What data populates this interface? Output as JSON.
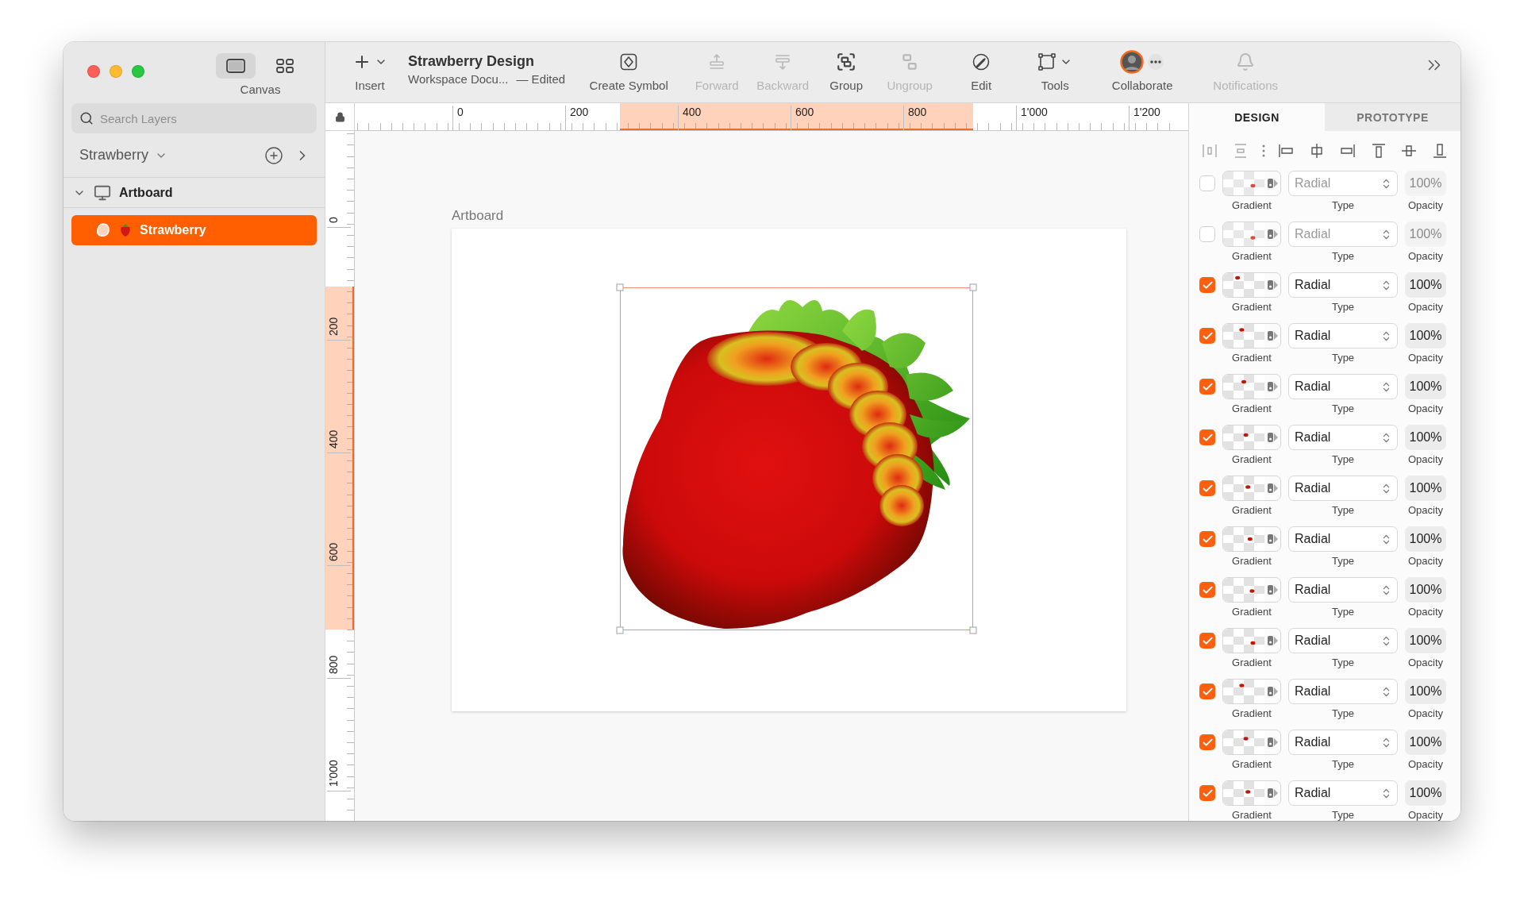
{
  "sidebar": {
    "view_switch": {
      "label": "Canvas",
      "options": [
        {
          "kind": "canvas",
          "selected": true
        },
        {
          "kind": "components",
          "selected": false
        }
      ]
    },
    "search": {
      "placeholder": "Search Layers"
    },
    "page": "Strawberry",
    "layers": [
      {
        "name": "Artboard",
        "expanded": true,
        "selected": false,
        "children": [
          {
            "name": "Strawberry",
            "selected": true
          }
        ]
      }
    ]
  },
  "toolbar": {
    "document": {
      "title": "Strawberry Design",
      "subtitle": "Workspace Docu...",
      "status": "— Edited"
    },
    "items": [
      {
        "kind": "insert",
        "label": "Insert",
        "disabled": false
      },
      {
        "kind": "create_symbol",
        "label": "Create Symbol",
        "disabled": false
      },
      {
        "kind": "forward",
        "label": "Forward",
        "disabled": true
      },
      {
        "kind": "backward",
        "label": "Backward",
        "disabled": true
      },
      {
        "kind": "group",
        "label": "Group",
        "disabled": false
      },
      {
        "kind": "ungroup",
        "label": "Ungroup",
        "disabled": true
      },
      {
        "kind": "edit",
        "label": "Edit",
        "disabled": false
      },
      {
        "kind": "tools",
        "label": "Tools",
        "disabled": false
      },
      {
        "kind": "collaborate",
        "label": "Collaborate",
        "disabled": false
      },
      {
        "kind": "notifications",
        "label": "Notifications",
        "disabled": true
      }
    ]
  },
  "rulers": {
    "horizontal": [
      "0",
      "200",
      "400",
      "600",
      "800",
      "1'000",
      "1'200"
    ],
    "vertical": [
      "0",
      "200",
      "400",
      "600",
      "800",
      "1'000"
    ]
  },
  "canvas": {
    "artboard_label": "Artboard"
  },
  "inspector": {
    "tabs": [
      {
        "label": "DESIGN",
        "selected": true
      },
      {
        "label": "PROTOTYPE",
        "selected": false
      }
    ],
    "fills": [
      {
        "enabled": false,
        "gradient_label": "Gradient",
        "type": "Radial",
        "type_label": "Type",
        "opacity": "100%",
        "opacity_label": "Opacity"
      },
      {
        "enabled": false,
        "gradient_label": "Gradient",
        "type": "Radial",
        "type_label": "Type",
        "opacity": "100%",
        "opacity_label": "Opacity"
      },
      {
        "enabled": true,
        "gradient_label": "Gradient",
        "type": "Radial",
        "type_label": "Type",
        "opacity": "100%",
        "opacity_label": "Opacity"
      },
      {
        "enabled": true,
        "gradient_label": "Gradient",
        "type": "Radial",
        "type_label": "Type",
        "opacity": "100%",
        "opacity_label": "Opacity"
      },
      {
        "enabled": true,
        "gradient_label": "Gradient",
        "type": "Radial",
        "type_label": "Type",
        "opacity": "100%",
        "opacity_label": "Opacity"
      },
      {
        "enabled": true,
        "gradient_label": "Gradient",
        "type": "Radial",
        "type_label": "Type",
        "opacity": "100%",
        "opacity_label": "Opacity"
      },
      {
        "enabled": true,
        "gradient_label": "Gradient",
        "type": "Radial",
        "type_label": "Type",
        "opacity": "100%",
        "opacity_label": "Opacity"
      },
      {
        "enabled": true,
        "gradient_label": "Gradient",
        "type": "Radial",
        "type_label": "Type",
        "opacity": "100%",
        "opacity_label": "Opacity"
      },
      {
        "enabled": true,
        "gradient_label": "Gradient",
        "type": "Radial",
        "type_label": "Type",
        "opacity": "100%",
        "opacity_label": "Opacity"
      },
      {
        "enabled": true,
        "gradient_label": "Gradient",
        "type": "Radial",
        "type_label": "Type",
        "opacity": "100%",
        "opacity_label": "Opacity"
      },
      {
        "enabled": true,
        "gradient_label": "Gradient",
        "type": "Radial",
        "type_label": "Type",
        "opacity": "100%",
        "opacity_label": "Opacity"
      },
      {
        "enabled": true,
        "gradient_label": "Gradient",
        "type": "Radial",
        "type_label": "Type",
        "opacity": "100%",
        "opacity_label": "Opacity"
      },
      {
        "enabled": true,
        "gradient_label": "Gradient",
        "type": "Radial",
        "type_label": "Type",
        "opacity": "100%",
        "opacity_label": "Opacity"
      }
    ]
  }
}
